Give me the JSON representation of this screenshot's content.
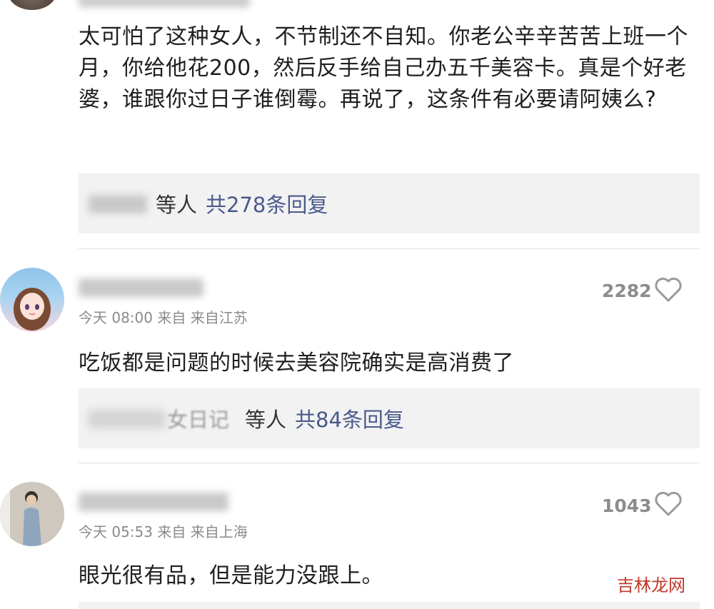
{
  "comments": [
    {
      "text": "太可怕了这种女人，不节制还不自知。你老公辛辛苦苦上班一个月，你给他花200，然后反手给自己办五千美容卡。真是个好老婆，谁跟你过日子谁倒霉。再说了，这条件有必要请阿姨么?",
      "reply_names": "等人",
      "reply_count": "共278条回复"
    },
    {
      "time": "今天 08:00 来自 来自江苏",
      "likes": "2282",
      "text": "吃饭都是问题的时候去美容院确实是高消费了",
      "reply_names_partial": "女日记",
      "reply_names": "等人",
      "reply_count": "共84条回复"
    },
    {
      "time": "今天 05:53 来自 来自上海",
      "likes": "1043",
      "text": "眼光很有品，但是能力没跟上。"
    }
  ],
  "watermark": "吉林龙网",
  "icons": {
    "like": "heart-outline-icon"
  },
  "colors": {
    "reply_link": "#4a5a8c",
    "reply_bg": "#f2f2f2",
    "meta": "#8a8a8a"
  }
}
